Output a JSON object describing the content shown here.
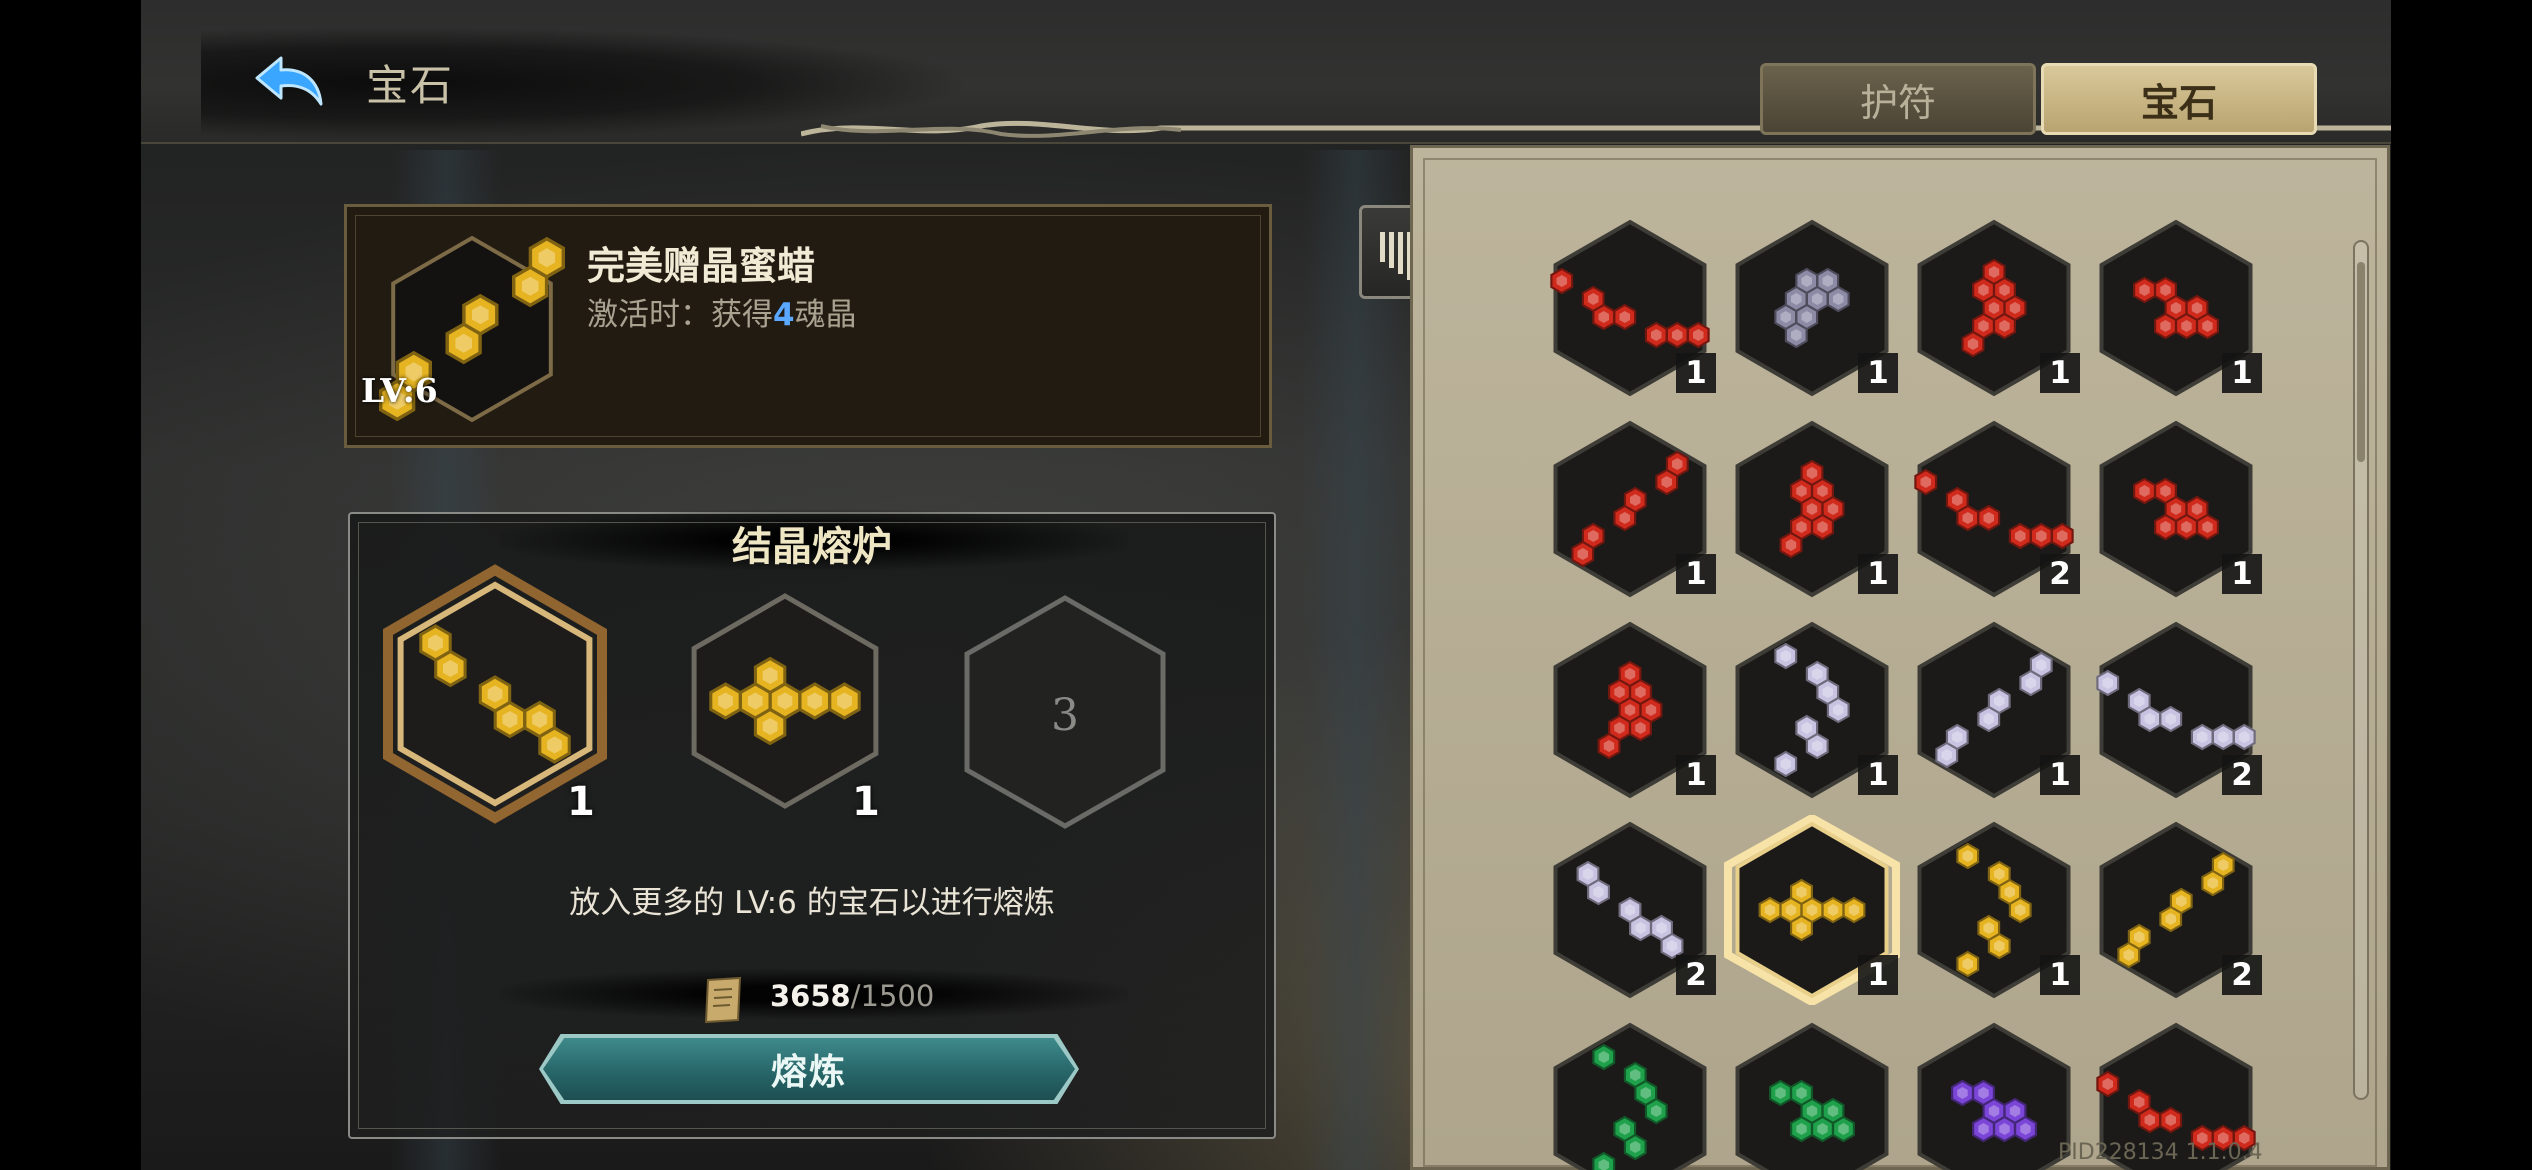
{
  "header": {
    "title": "宝石",
    "tabs": [
      {
        "label": "护符",
        "active": false
      },
      {
        "label": "宝石",
        "active": true
      }
    ]
  },
  "selected_gem": {
    "name": "完美赠晶蜜蜡",
    "desc_prefix": "激活时：获得",
    "desc_number": "4",
    "desc_suffix": "魂晶",
    "level": "LV:6",
    "color": "#e6b421"
  },
  "furnace": {
    "title": "结晶熔炉",
    "slots": [
      {
        "count": "1",
        "color": "#e6b421",
        "pattern": "diag"
      },
      {
        "count": "1",
        "color": "#e6b421",
        "pattern": "cross"
      },
      {
        "label": "3"
      }
    ],
    "hint": "放入更多的 LV:6 的宝石以进行熔炼",
    "cost_have": "3658",
    "cost_need": "/1500",
    "button_label": "熔炼"
  },
  "inventory": {
    "items": [
      {
        "color": "#d02a1c",
        "count": "1",
        "pattern": "chain"
      },
      {
        "color": "#8d8aa6",
        "count": "1",
        "pattern": "cluster"
      },
      {
        "color": "#d02a1c",
        "count": "1",
        "pattern": "column"
      },
      {
        "color": "#d02a1c",
        "count": "1",
        "pattern": "tri"
      },
      {
        "color": "#d02a1c",
        "count": "1",
        "pattern": "rdiag"
      },
      {
        "color": "#d02a1c",
        "count": "1",
        "pattern": "column"
      },
      {
        "color": "#d02a1c",
        "count": "2",
        "pattern": "chain"
      },
      {
        "color": "#d02a1c",
        "count": "1",
        "pattern": "tri"
      },
      {
        "color": "#d02a1c",
        "count": "1",
        "pattern": "column"
      },
      {
        "color": "#c9c3e2",
        "count": "1",
        "pattern": "snake"
      },
      {
        "color": "#c9c3e2",
        "count": "1",
        "pattern": "rdiag"
      },
      {
        "color": "#c9c3e2",
        "count": "2",
        "pattern": "chain"
      },
      {
        "color": "#c9c3e2",
        "count": "2",
        "pattern": "diag"
      },
      {
        "color": "#e6b421",
        "count": "1",
        "pattern": "cross",
        "selected": true
      },
      {
        "color": "#e6b421",
        "count": "1",
        "pattern": "snake"
      },
      {
        "color": "#e6b421",
        "count": "2",
        "pattern": "rdiag"
      },
      {
        "color": "#1fa04a",
        "count": "",
        "pattern": "snake"
      },
      {
        "color": "#1fa04a",
        "count": "",
        "pattern": "tri"
      },
      {
        "color": "#7b45d8",
        "count": "",
        "pattern": "tri"
      },
      {
        "color": "#d02a1c",
        "count": "",
        "pattern": "chain"
      }
    ]
  },
  "version": "PID228134  1.1.0.4",
  "icons": {
    "back": "back-arrow-icon",
    "sort": "sort-icon",
    "cost": "scroll-icon"
  }
}
